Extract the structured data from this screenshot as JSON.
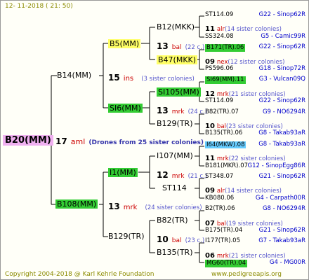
{
  "header": {
    "date": "12-  11-2018  (  21:  50)"
  },
  "footer": {
    "copyright": "Copyright 2004-2018 @ Karl Kehrle Foundation",
    "url": "www.pedigreeapis.org"
  },
  "root": {
    "name": "B20(MM)",
    "num": "17",
    "breeder": "aml",
    "drones": "(Drones from 25 sister colonies)"
  },
  "gen1": [
    {
      "name": "B14(MM)",
      "num": "15",
      "breeder": "ins",
      "sisters": "(3 sister colonies)"
    },
    {
      "name": "B108(MM)",
      "num": "13",
      "breeder": "mrk",
      "sisters": "(24 sister colonies)"
    }
  ],
  "gen2": [
    {
      "name": "B5(MM)",
      "num": "13",
      "breeder": "bal",
      "sisters": "(22 c.)"
    },
    {
      "name": "SI6(MM)",
      "num": "13",
      "breeder": "mrk",
      "sisters": "(24 c.)"
    },
    {
      "name": "I1(MM)",
      "num": "12",
      "breeder": "mrk",
      "sisters": "(21 c.)"
    },
    {
      "name": "B129(TR)",
      "num": "10",
      "breeder": "bal",
      "sisters": "(23 c.)"
    }
  ],
  "gen3": [
    {
      "name": "B12(MKK)"
    },
    {
      "name": "B47(MKK)"
    },
    {
      "name": "SI105(MM)"
    },
    {
      "name": "B129(TR)"
    },
    {
      "name": "I107(MM)"
    },
    {
      "name": "ST114"
    },
    {
      "name": "B82(TR)"
    },
    {
      "name": "B135(TR)"
    }
  ],
  "gen4": [
    {
      "name": "ST114.09",
      "right": "G22 - Sinop62R"
    },
    {
      "num": "11",
      "breeder": "alr",
      "sisters": "(14 sister colonies)"
    },
    {
      "name": "SS324.08",
      "right": "G5 - Camic99R"
    },
    {
      "name": "B171(TR).06",
      "right": "G22 - Sinop62R"
    },
    {
      "num": "09",
      "breeder": "nex",
      "sisters": "(12 sister colonies)"
    },
    {
      "name": "PS596.06",
      "right": "G18 - Sinop72R"
    },
    {
      "name": "SI69(MM).11",
      "right": "G3 - Vulcan09Q"
    },
    {
      "num": "12",
      "breeder": "mrk",
      "sisters": "(21 sister colonies)"
    },
    {
      "name": "ST114.09",
      "right": "G22 - Sinop62R"
    },
    {
      "name": "B82(TR).07",
      "right": "G9 - NO6294R"
    },
    {
      "num": "10",
      "breeder": "bal",
      "sisters": "(23 sister colonies)"
    },
    {
      "name": "B135(TR).06",
      "right": "G8 - Takab93aR"
    },
    {
      "name": "I64(MKW).08",
      "right": "G8 - Takab93aR"
    },
    {
      "num": "11",
      "breeder": "mrk",
      "sisters": "(22 sister colonies)"
    },
    {
      "name": "B181(MKR).07",
      "right": "G12 - SinopEgg86R"
    },
    {
      "name": "ST348.07",
      "right": "G21 - Sinop62R"
    },
    {
      "num": "09",
      "breeder": "alr",
      "sisters": "(14 sister colonies)"
    },
    {
      "name": "KB080.06",
      "right": "G4 - Carpath00R"
    },
    {
      "name": "B2(TR).06",
      "right": "G8 - NO6294R"
    },
    {
      "num": "07",
      "breeder": "bal",
      "sisters": "(19 sister colonies)"
    },
    {
      "name": "B175(TR).04",
      "right": "G21 - Sinop62R"
    },
    {
      "name": "I177(TR).05",
      "right": "G7 - Takab93aR"
    },
    {
      "num": "06",
      "breeder": "mrk",
      "sisters": "(21 sister colonies)"
    },
    {
      "name": "MG60(TR).04",
      "right": "G4 - MG00R"
    }
  ]
}
